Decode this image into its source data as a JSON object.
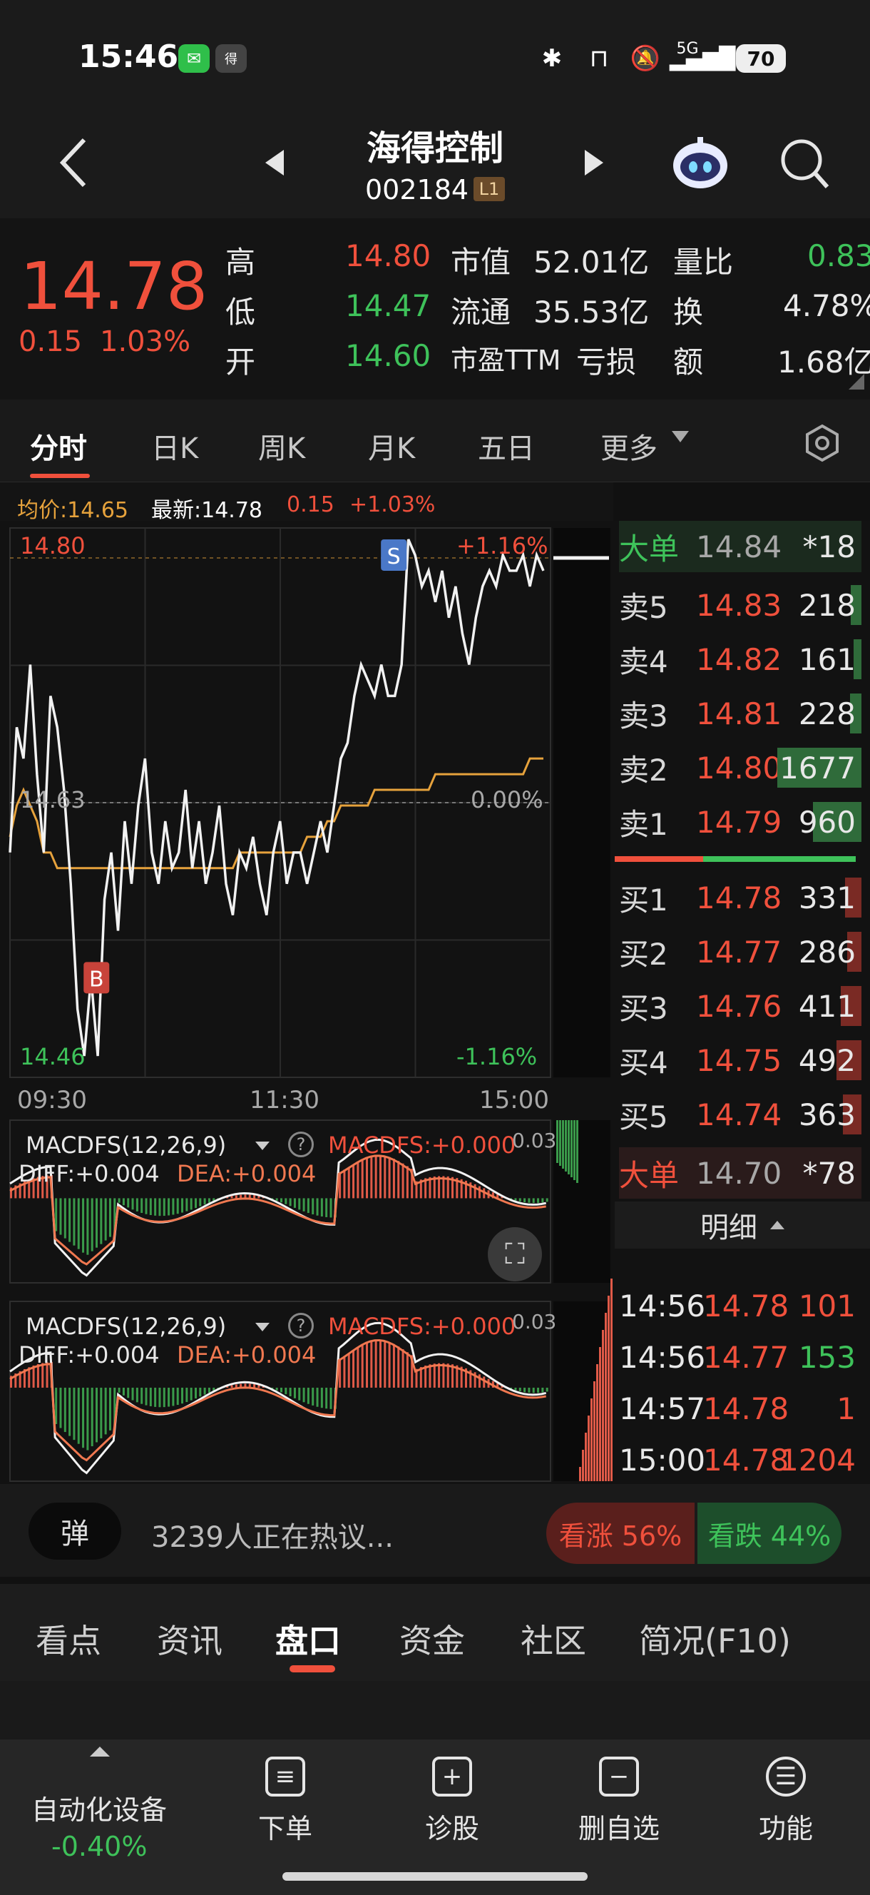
{
  "status_bar": {
    "time": "15:46",
    "network": "5G",
    "battery": "70"
  },
  "header": {
    "title": "海得控制",
    "code": "002184",
    "level_badge": "L1"
  },
  "quote": {
    "price": "14.78",
    "change": "0.15",
    "change_pct": "1.03%",
    "rows": [
      {
        "k1": "高",
        "v1": "14.80",
        "k2": "市值",
        "v2": "52.01亿",
        "k3": "量比",
        "v3": "0.83"
      },
      {
        "k1": "低",
        "v1": "14.47",
        "k2": "流通",
        "v2": "35.53亿",
        "k3": "换",
        "v3": "4.78%"
      },
      {
        "k1": "开",
        "v1": "14.60",
        "k2": "市盈TTM",
        "v2": "亏损",
        "k3": "额",
        "v3": "1.68亿"
      }
    ]
  },
  "ktabs": [
    "分时",
    "日K",
    "周K",
    "月K",
    "五日",
    "更多"
  ],
  "legend": {
    "avg_label": "均价:14.65",
    "last_label": "最新:14.78",
    "change": "0.15",
    "change_pct": "+1.03%"
  },
  "chart_data": {
    "type": "line",
    "time_labels": [
      "09:30",
      "11:30",
      "15:00"
    ],
    "y_labels": {
      "high": "14.80",
      "mid": "14.63",
      "low": "14.46"
    },
    "pct_labels": {
      "high": "+1.16%",
      "mid": "0.00%",
      "low": "-1.16%"
    },
    "ylim": [
      14.46,
      14.8
    ],
    "markers": [
      {
        "label": "B",
        "t": 0.16,
        "price": 14.52
      },
      {
        "label": "S",
        "t": 0.71,
        "price": 14.79
      }
    ],
    "price_series": [
      14.6,
      14.68,
      14.66,
      14.72,
      14.65,
      14.6,
      14.7,
      14.68,
      14.64,
      14.58,
      14.5,
      14.47,
      14.52,
      14.47,
      14.57,
      14.6,
      14.55,
      14.62,
      14.58,
      14.63,
      14.66,
      14.6,
      14.58,
      14.62,
      14.59,
      14.6,
      14.64,
      14.59,
      14.62,
      14.58,
      14.6,
      14.63,
      14.58,
      14.56,
      14.6,
      14.59,
      14.61,
      14.58,
      14.56,
      14.6,
      14.62,
      14.58,
      14.6,
      14.6,
      14.58,
      14.6,
      14.62,
      14.6,
      14.63,
      14.66,
      14.67,
      14.7,
      14.72,
      14.71,
      14.7,
      14.72,
      14.7,
      14.7,
      14.72,
      14.8,
      14.79,
      14.77,
      14.78,
      14.76,
      14.78,
      14.75,
      14.77,
      14.74,
      14.72,
      14.75,
      14.77,
      14.78,
      14.77,
      14.79,
      14.78,
      14.78,
      14.79,
      14.77,
      14.79,
      14.78
    ],
    "avg_series": [
      14.61,
      14.63,
      14.64,
      14.63,
      14.62,
      14.6,
      14.6,
      14.59,
      14.59,
      14.59,
      14.59,
      14.59,
      14.59,
      14.59,
      14.59,
      14.59,
      14.59,
      14.59,
      14.59,
      14.59,
      14.59,
      14.59,
      14.59,
      14.59,
      14.59,
      14.59,
      14.59,
      14.59,
      14.59,
      14.59,
      14.59,
      14.59,
      14.59,
      14.59,
      14.6,
      14.6,
      14.6,
      14.6,
      14.6,
      14.6,
      14.6,
      14.6,
      14.6,
      14.6,
      14.61,
      14.61,
      14.61,
      14.62,
      14.62,
      14.63,
      14.63,
      14.63,
      14.63,
      14.63,
      14.64,
      14.64,
      14.64,
      14.64,
      14.64,
      14.64,
      14.64,
      14.64,
      14.64,
      14.65,
      14.65,
      14.65,
      14.65,
      14.65,
      14.65,
      14.65,
      14.65,
      14.65,
      14.65,
      14.65,
      14.65,
      14.65,
      14.65,
      14.66,
      14.66,
      14.66
    ]
  },
  "macd_panels": [
    {
      "title": "MACDFS(12,26,9)",
      "macdfs": "MACDFS:+0.000",
      "diff": "DIFF:+0.004",
      "dea": "DEA:+0.004",
      "scale": "0.03"
    },
    {
      "title": "MACDFS(12,26,9)",
      "macdfs": "MACDFS:+0.000",
      "diff": "DIFF:+0.004",
      "dea": "DEA:+0.004",
      "scale": "0.03"
    }
  ],
  "orderbook": {
    "big_top": {
      "label": "大单",
      "price": "14.84",
      "vol": "*18"
    },
    "asks": [
      {
        "label": "卖5",
        "price": "14.83",
        "vol": "218"
      },
      {
        "label": "卖4",
        "price": "14.82",
        "vol": "161"
      },
      {
        "label": "卖3",
        "price": "14.81",
        "vol": "228"
      },
      {
        "label": "卖2",
        "price": "14.80",
        "vol": "1677"
      },
      {
        "label": "卖1",
        "price": "14.79",
        "vol": "960"
      }
    ],
    "bids": [
      {
        "label": "买1",
        "price": "14.78",
        "vol": "331"
      },
      {
        "label": "买2",
        "price": "14.77",
        "vol": "286"
      },
      {
        "label": "买3",
        "price": "14.76",
        "vol": "411"
      },
      {
        "label": "买4",
        "price": "14.75",
        "vol": "492"
      },
      {
        "label": "买5",
        "price": "14.74",
        "vol": "363"
      }
    ],
    "big_bottom": {
      "label": "大单",
      "price": "14.70",
      "vol": "*78"
    }
  },
  "detail": {
    "header": "明细",
    "rows": [
      {
        "time": "14:56",
        "price": "14.78",
        "vol": "101",
        "dir": "up"
      },
      {
        "time": "14:56",
        "price": "14.77",
        "vol": "153",
        "dir": "down"
      },
      {
        "time": "14:57",
        "price": "14.78",
        "vol": "1",
        "dir": "up"
      },
      {
        "time": "15:00",
        "price": "14.78",
        "vol": "1204",
        "dir": "up"
      }
    ]
  },
  "sentiment": {
    "danmu": "弹",
    "discuss": "3239人正在热议...",
    "bull": "看涨 56%",
    "bear": "看跌 44%",
    "bull_pct": 56
  },
  "bottom_tabs": [
    "看点",
    "资讯",
    "盘口",
    "资金",
    "社区",
    "简况(F10)"
  ],
  "nav": {
    "sector": "自动化设备",
    "sector_change": "-0.40%",
    "items": [
      {
        "label": "下单",
        "icon": "order-icon"
      },
      {
        "label": "诊股",
        "icon": "diagnose-icon"
      },
      {
        "label": "删自选",
        "icon": "remove-watch-icon"
      },
      {
        "label": "功能",
        "icon": "menu-icon"
      }
    ]
  },
  "colors": {
    "up": "#f0503c",
    "down": "#3ec25a",
    "avg_line": "#e6a23c",
    "price_line": "#f2f2f2"
  }
}
